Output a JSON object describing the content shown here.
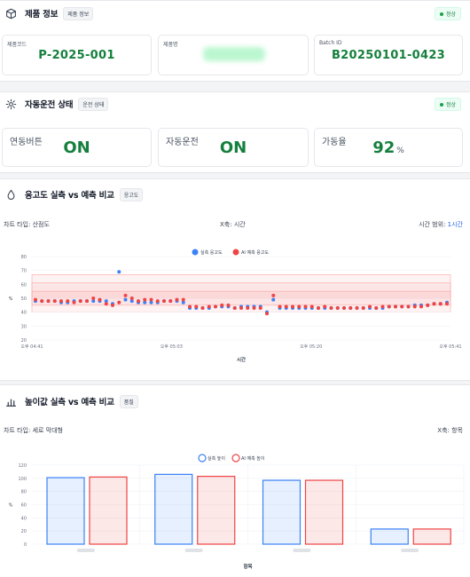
{
  "product": {
    "title": "제품 정보",
    "tag": "제품 정보",
    "status": "정상",
    "code_label": "제품코드",
    "code_value": "P-2025-001",
    "name_label": "제품명",
    "batch_label": "Batch ID",
    "batch_value": "B20250101-0423"
  },
  "auto": {
    "title": "자동운전 상태",
    "tag": "운전 상태",
    "status": "정상",
    "interlock_label": "연동버튼",
    "interlock_value": "ON",
    "auto_label": "자동운전",
    "auto_value": "ON",
    "rate_label": "가동율",
    "rate_value": "92",
    "rate_unit": "%"
  },
  "viscosity": {
    "title": "응고도 실측 vs 예측 비교",
    "tag": "응고도",
    "chart_type": "차트 타입: 산점도",
    "x_axis": "X축: 시간",
    "range_label": "시간 범위:",
    "range_value": "1시간"
  },
  "height": {
    "title": "높이값 실측 vs 예측 비교",
    "tag": "품질",
    "chart_type": "차트 타입: 세로 막대형",
    "x_axis": "X축: 항목"
  },
  "colors": {
    "actual": "#3b82f6",
    "predicted": "#ef4444",
    "ok": "#15803d"
  },
  "chart_data": [
    {
      "type": "scatter",
      "title": "",
      "xlabel": "시간",
      "ylabel": "%",
      "ylim": [
        20,
        80
      ],
      "yticks": [
        20,
        30,
        40,
        50,
        60,
        70,
        80
      ],
      "xticks": [
        "오후 04:41",
        "오후 05:03",
        "오후 05:20",
        "오후 05:41"
      ],
      "bands": [
        [
          40,
          67
        ],
        [
          45,
          61
        ],
        [
          50,
          55
        ]
      ],
      "legend": "top",
      "series": [
        {
          "name": "실측 응고도",
          "values": [
            48,
            48,
            48,
            48,
            47,
            47,
            48,
            48,
            48,
            48,
            48,
            48,
            46,
            69,
            49,
            48,
            47,
            47,
            47,
            47,
            48,
            48,
            48,
            47,
            43,
            43,
            43,
            43,
            44,
            44,
            44,
            43,
            44,
            44,
            44,
            44,
            40,
            49,
            43,
            43,
            43,
            43,
            43,
            43,
            43,
            43,
            43,
            43,
            43,
            43,
            43,
            43,
            43,
            43,
            43,
            44,
            44,
            44,
            44,
            45,
            45,
            45,
            46,
            46,
            47
          ]
        },
        {
          "name": "AI 예측 응고도",
          "values": [
            49,
            48,
            48,
            48,
            48,
            48,
            47,
            48,
            48,
            50,
            49,
            46,
            45,
            47,
            52,
            50,
            48,
            49,
            49,
            48,
            48,
            48,
            49,
            49,
            44,
            44,
            43,
            44,
            44,
            45,
            45,
            43,
            43,
            43,
            43,
            43,
            39,
            52,
            44,
            44,
            44,
            44,
            44,
            44,
            43,
            44,
            43,
            43,
            43,
            43,
            43,
            43,
            44,
            43,
            44,
            44,
            44,
            44,
            44,
            44,
            44,
            45,
            46,
            46,
            46
          ]
        }
      ]
    },
    {
      "type": "bar",
      "title": "",
      "xlabel": "항목",
      "ylabel": "%",
      "ylim": [
        0,
        120
      ],
      "yticks": [
        0,
        20,
        40,
        60,
        80,
        100,
        120
      ],
      "legend": "top",
      "series": [
        {
          "name": "실측 높이",
          "values": [
            101,
            106,
            97,
            23
          ]
        },
        {
          "name": "AI 예측 높이",
          "values": [
            102,
            103,
            97,
            23
          ]
        }
      ]
    }
  ]
}
